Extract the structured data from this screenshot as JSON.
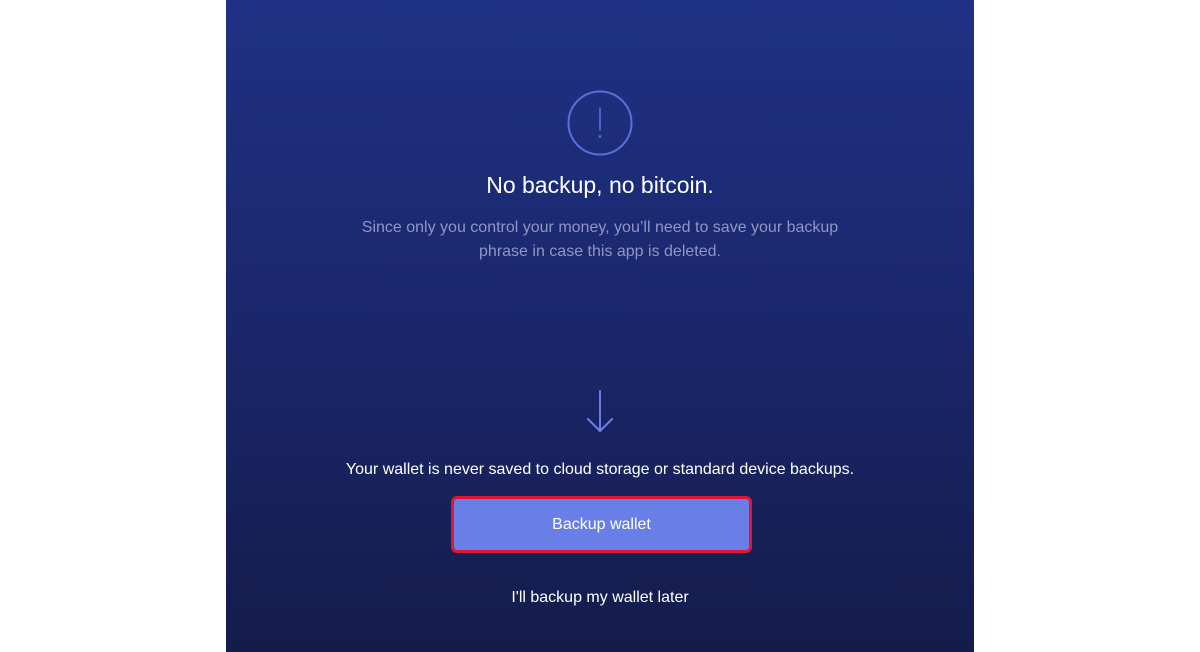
{
  "screen": {
    "title": "No backup, no bitcoin.",
    "subtitle": "Since only you control your money, you’ll need to save your backup phrase in case this app is deleted.",
    "note": "Your wallet is never saved to cloud storage or standard device backups.",
    "primary_button_label": "Backup wallet",
    "secondary_link_label": "I'll backup my wallet later"
  },
  "icons": {
    "top": "exclamation-circle-icon",
    "middle": "arrow-down-icon"
  },
  "colors": {
    "gradient_top": "#1f3184",
    "gradient_bottom": "#141c4b",
    "accent": "#6a7ee8",
    "focus_outline": "#e0153a",
    "subtitle_text": "#8f97c2"
  }
}
